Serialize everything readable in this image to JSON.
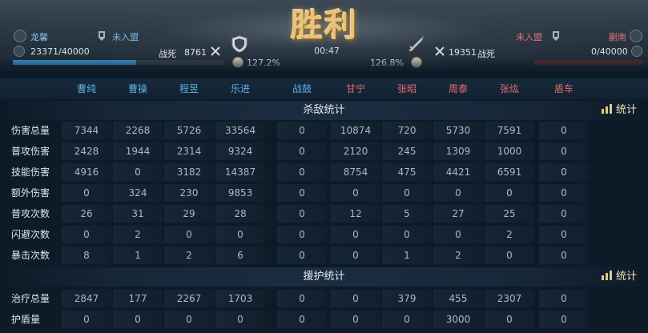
{
  "result": {
    "title": "胜利",
    "time": "00:47"
  },
  "left_player": {
    "name": "龙馨",
    "alliance": "未入盟",
    "troops": "23371/40000",
    "deaths_label": "战死",
    "deaths": "8761",
    "pct": "127.2%",
    "troop_fraction": 0.584
  },
  "right_player": {
    "name": "蒯南",
    "alliance": "未入盟",
    "troops": "0/40000",
    "deaths_label": "战死",
    "deaths": "19351",
    "pct": "126.8%",
    "troop_fraction": 0.0
  },
  "heroes": [
    {
      "name": "曹纯",
      "side": "left"
    },
    {
      "name": "曹操",
      "side": "left"
    },
    {
      "name": "程昱",
      "side": "left"
    },
    {
      "name": "乐进",
      "side": "left"
    },
    {
      "name": "战鼓",
      "side": "left"
    },
    {
      "name": "甘宁",
      "side": "right"
    },
    {
      "name": "张昭",
      "side": "right"
    },
    {
      "name": "周泰",
      "side": "right"
    },
    {
      "name": "张纮",
      "side": "right"
    },
    {
      "name": "盾车",
      "side": "right"
    }
  ],
  "colors": {
    "left_team": "#5fb0e6",
    "right_team": "#e36c6c",
    "title_gold": "#e7c27a"
  },
  "kill_stats": {
    "title": "杀敌统计",
    "button": "统计",
    "rows": [
      {
        "label": "伤害总量",
        "values": [
          "7344",
          "2268",
          "5726",
          "33564",
          "0",
          "10874",
          "720",
          "5730",
          "7591",
          "0"
        ]
      },
      {
        "label": "普攻伤害",
        "values": [
          "2428",
          "1944",
          "2314",
          "9324",
          "0",
          "2120",
          "245",
          "1309",
          "1000",
          "0"
        ]
      },
      {
        "label": "技能伤害",
        "values": [
          "4916",
          "0",
          "3182",
          "14387",
          "0",
          "8754",
          "475",
          "4421",
          "6591",
          "0"
        ]
      },
      {
        "label": "额外伤害",
        "values": [
          "0",
          "324",
          "230",
          "9853",
          "0",
          "0",
          "0",
          "0",
          "0",
          "0"
        ]
      },
      {
        "label": "普攻次数",
        "values": [
          "26",
          "31",
          "29",
          "28",
          "0",
          "12",
          "5",
          "27",
          "25",
          "0"
        ]
      },
      {
        "label": "闪避次数",
        "values": [
          "0",
          "2",
          "0",
          "0",
          "0",
          "0",
          "0",
          "0",
          "2",
          "0"
        ]
      },
      {
        "label": "暴击次数",
        "values": [
          "8",
          "1",
          "2",
          "6",
          "0",
          "0",
          "1",
          "2",
          "0",
          "0"
        ]
      }
    ]
  },
  "support_stats": {
    "title": "援护统计",
    "button": "统计",
    "rows": [
      {
        "label": "治疗总量",
        "values": [
          "2847",
          "177",
          "2267",
          "1703",
          "0",
          "0",
          "379",
          "455",
          "2307",
          "0"
        ]
      },
      {
        "label": "护盾量",
        "values": [
          "0",
          "0",
          "0",
          "0",
          "0",
          "0",
          "0",
          "3000",
          "0",
          "0"
        ]
      }
    ]
  }
}
